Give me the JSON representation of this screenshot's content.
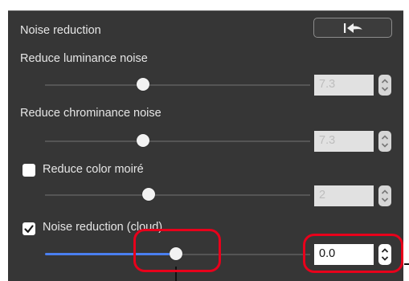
{
  "panel": {
    "title": "Noise reduction",
    "reset_button_icon": "reset-arrow-icon"
  },
  "luminance": {
    "label": "Reduce luminance noise",
    "value": "7.3",
    "slider_fraction": 0.37,
    "enabled": false
  },
  "chrominance": {
    "label": "Reduce chrominance noise",
    "value": "7.3",
    "slider_fraction": 0.37,
    "enabled": false
  },
  "moire": {
    "label": "Reduce color moiré",
    "checked": false,
    "value": "2",
    "slider_fraction": 0.39,
    "enabled": false
  },
  "cloud": {
    "label": "Noise reduction (cloud)",
    "checked": true,
    "value": "0.0",
    "slider_fraction": 0.49,
    "enabled": true
  },
  "colors": {
    "panel_bg": "#363636",
    "accent_blue": "#4a7ff0",
    "highlight_red": "#e8001b"
  }
}
